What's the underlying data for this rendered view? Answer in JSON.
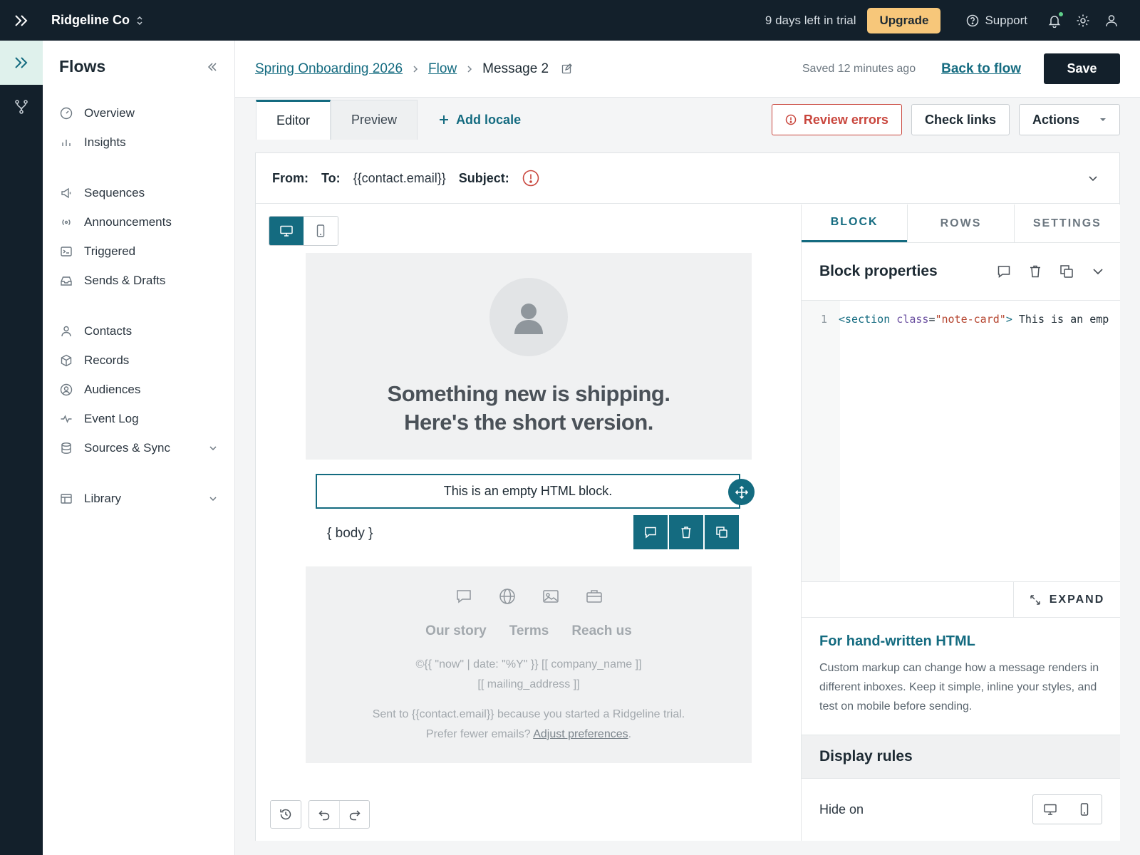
{
  "topbar": {
    "org_name": "Ridgeline Co",
    "trial_text": "9 days left in trial",
    "upgrade_label": "Upgrade",
    "support_label": "Support"
  },
  "sidebar": {
    "title": "Flows",
    "groups": [
      [
        {
          "label": "Overview",
          "icon": "gauge-icon"
        },
        {
          "label": "Insights",
          "icon": "bar-chart-icon"
        }
      ],
      [
        {
          "label": "Sequences",
          "icon": "megaphone-icon"
        },
        {
          "label": "Announcements",
          "icon": "broadcast-icon"
        },
        {
          "label": "Triggered",
          "icon": "terminal-icon"
        },
        {
          "label": "Sends & Drafts",
          "icon": "inbox-icon"
        }
      ],
      [
        {
          "label": "Contacts",
          "icon": "person-icon"
        },
        {
          "label": "Records",
          "icon": "cube-icon"
        },
        {
          "label": "Audiences",
          "icon": "user-circle-icon"
        },
        {
          "label": "Event Log",
          "icon": "activity-icon"
        },
        {
          "label": "Sources & Sync",
          "icon": "database-icon",
          "expandable": true
        }
      ],
      [
        {
          "label": "Library",
          "icon": "layout-icon",
          "expandable": true
        }
      ]
    ]
  },
  "header": {
    "breadcrumb": [
      "Spring Onboarding 2026",
      "Flow"
    ],
    "current": "Message 2",
    "saved_text": "Saved 12 minutes ago",
    "back_label": "Back to flow",
    "save_label": "Save"
  },
  "tabs": {
    "editor": "Editor",
    "preview": "Preview",
    "add_locale": "Add locale",
    "review_errors": "Review errors",
    "check_links": "Check links",
    "actions": "Actions"
  },
  "meta": {
    "from_label": "From:",
    "to_label": "To:",
    "to_value": "{{contact.email}}",
    "subject_label": "Subject:"
  },
  "email": {
    "headline_1": "Something new is shipping.",
    "headline_2": "Here's the short version.",
    "html_block_text": "This is an empty HTML block.",
    "body_token": "{ body }",
    "footer_links": [
      "Our story",
      "Terms",
      "Reach us"
    ],
    "legal_1": "©{{ \"now\" | date: \"%Y\" }} [[ company_name ]]",
    "legal_2": "[[ mailing_address ]]",
    "sent_1": "Sent to {{contact.email}} because you started a Ridgeline",
    "sent_2": "trial. Prefer fewer emails?",
    "adjust_label": "Adjust preferences",
    "sent_end": "."
  },
  "panel": {
    "tabs": [
      "BLOCK",
      "ROWS",
      "SETTINGS"
    ],
    "title": "Block properties",
    "code_line_number": "1",
    "code": {
      "open": "<section",
      "attr": "class",
      "eq": "=",
      "value": "\"note-card\"",
      "close": ">",
      "text": " This is an emp"
    },
    "expand_label": "EXPAND",
    "tip_title": "For hand-written HTML",
    "tip_text": "Custom markup can change how a message renders in different inboxes. Keep it simple, inline your styles, and test on mobile before sending.",
    "rules_title": "Display rules",
    "hide_on_label": "Hide on"
  },
  "colors": {
    "accent": "#146b80",
    "topbar": "#13202b",
    "upgrade": "#f7c77a",
    "error": "#c9463d"
  }
}
